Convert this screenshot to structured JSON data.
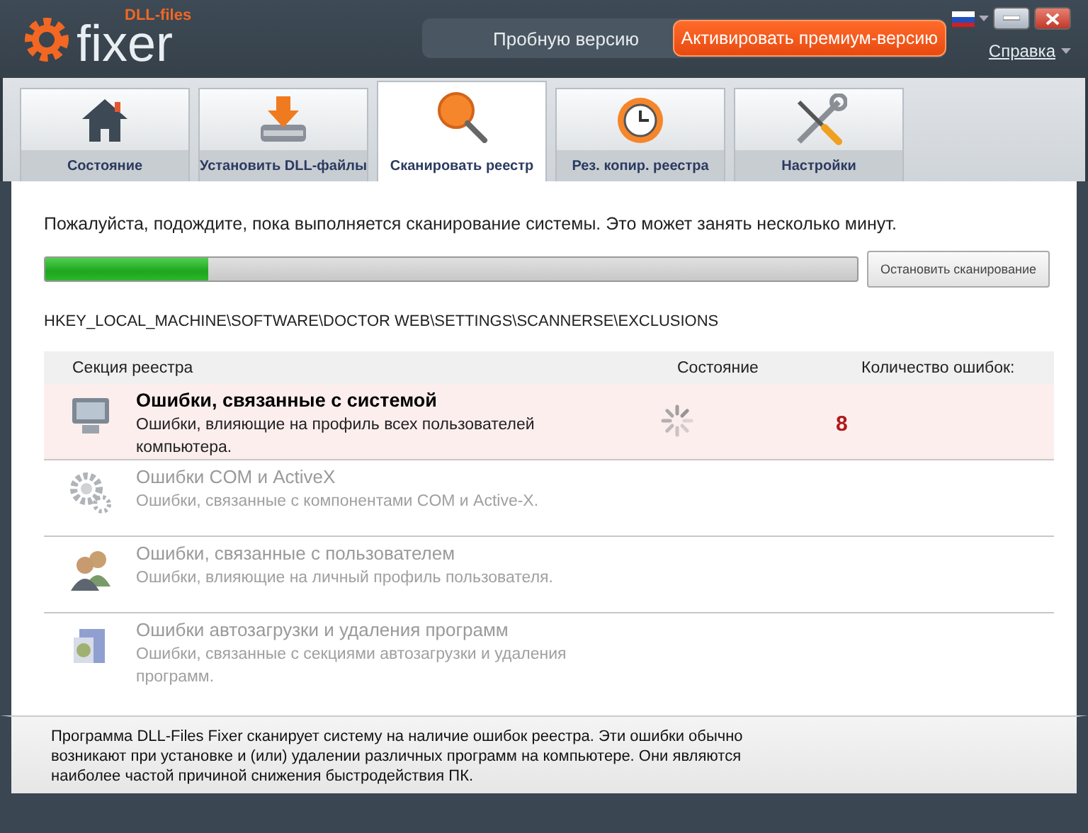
{
  "header": {
    "logo_small": "DLL-files",
    "logo_big": "fixer",
    "trial": "Пробную версию",
    "premium_button": "Активировать премиум-версию",
    "help_link": "Справка"
  },
  "tabs": [
    {
      "label": "Состояние",
      "selected": false
    },
    {
      "label": "Установить DLL-файлы",
      "selected": false
    },
    {
      "label": "Сканировать реестр",
      "selected": true
    },
    {
      "label": "Рез. копир. реестра",
      "selected": false
    },
    {
      "label": "Настройки",
      "selected": false
    }
  ],
  "scan": {
    "message": "Пожалуйста, подождите, пока выполняется сканирование системы. Это может занять несколько минут.",
    "progress": {
      "level": 0.2
    },
    "stop_button": "Остановить сканирование",
    "current_path": "HKEY_LOCAL_MACHINE\\SOFTWARE\\DOCTOR WEB\\SETTINGS\\SCANNERSE\\EXCLUSIONS"
  },
  "table": {
    "columns": [
      "Секция реестра",
      "Состояние",
      "Количество ошибок:"
    ],
    "rows": [
      {
        "title": "Ошибки, связанные с системой",
        "description": "Ошибки, влияющие на профиль всех пользователей компьютера.",
        "active": true,
        "errors": "8"
      },
      {
        "title": "Ошибки COM и ActiveX",
        "description": "Ошибки, связанные с компонентами COM и Active-X.",
        "active": false
      },
      {
        "title": "Ошибки, связанные с пользователем",
        "description": "Ошибки, влияющие на личный профиль пользователя.",
        "active": false
      },
      {
        "title": "Ошибки автозагрузки и удаления программ",
        "description": "Ошибки, связанные с секциями автозагрузки и удаления программ.",
        "active": false
      }
    ]
  },
  "footer": "Программа DLL-Files Fixer сканирует систему на наличие ошибок реестра. Эти ошибки обычно возникают при установке и (или) удалении различных программ на компьютере. Они являются наиболее частой причиной снижения быстродействия ПК."
}
